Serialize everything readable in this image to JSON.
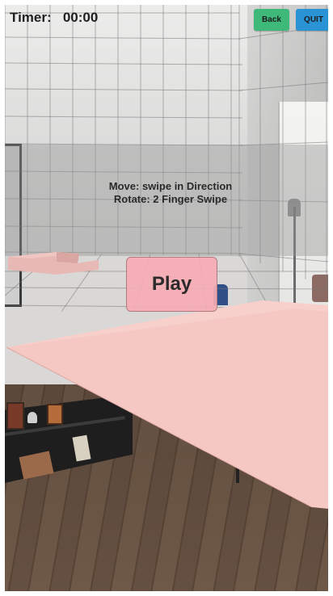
{
  "hud": {
    "timer_label": "Timer:",
    "timer_value": "00:00",
    "back_label": "Back",
    "quit_label": "QUIT"
  },
  "instructions": {
    "line1": "Move: swipe in Direction",
    "line2": "Rotate: 2 Finger Swipe"
  },
  "play": {
    "label": "Play"
  },
  "colors": {
    "back_button": "#3fb97a",
    "quit_button": "#2a93d6",
    "play_button": "#f5acb4",
    "game_plane": "#f6c8c4"
  }
}
